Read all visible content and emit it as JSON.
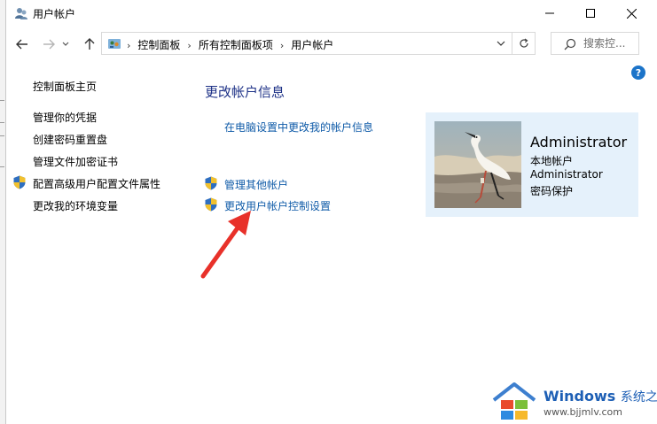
{
  "window": {
    "title": "用户帐户",
    "controls": {
      "minimize": "minimize-icon",
      "maximize": "maximize-icon",
      "close": "close-icon"
    }
  },
  "nav": {
    "back_icon": "arrow-left-icon",
    "forward_icon": "arrow-right-icon",
    "history_icon": "chevron-down-icon",
    "up_icon": "arrow-up-icon",
    "breadcrumb": [
      "控制面板",
      "所有控制面板项",
      "用户帐户"
    ],
    "refresh_icon": "refresh-icon",
    "search_placeholder": "搜索控..."
  },
  "help_label": "?",
  "sidebar": {
    "home": "控制面板主页",
    "links": [
      {
        "label": "管理你的凭据",
        "shield": false
      },
      {
        "label": "创建密码重置盘",
        "shield": false
      },
      {
        "label": "管理文件加密证书",
        "shield": false
      },
      {
        "label": "配置高级用户配置文件属性",
        "shield": true
      },
      {
        "label": "更改我的环境变量",
        "shield": false
      }
    ]
  },
  "main": {
    "heading": "更改帐户信息",
    "pc_settings_link": "在电脑设置中更改我的帐户信息",
    "links": [
      {
        "label": "管理其他帐户",
        "shield": true
      },
      {
        "label": "更改用户帐户控制设置",
        "shield": true
      }
    ]
  },
  "account": {
    "name": "Administrator",
    "type": "本地帐户",
    "username": "Administrator",
    "status": "密码保护"
  },
  "watermark": {
    "brand": "Windows",
    "brand_suffix": "系统之家",
    "url": "www.bjjmlv.com"
  },
  "colors": {
    "link": "#0f5ba8",
    "heading": "#1e3287",
    "card_bg": "#e5f1fb",
    "annotation_arrow": "#e8312a"
  }
}
